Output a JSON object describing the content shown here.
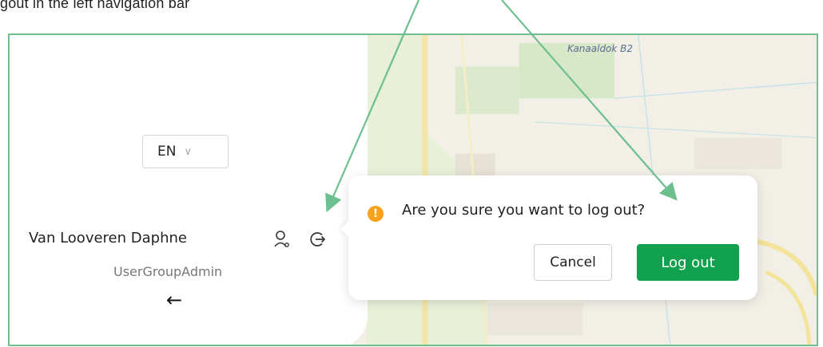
{
  "caption": "gout in the left navigation bar",
  "map": {
    "place_label": "Kanaaldok B2"
  },
  "sidebar": {
    "language": "EN",
    "user_name": "Van Looveren Daphne",
    "user_role": "UserGroupAdmin",
    "collapse_glyph": "←"
  },
  "popover": {
    "message": "Are you sure you want to log out?",
    "cancel_label": "Cancel",
    "confirm_label": "Log out"
  },
  "colors": {
    "annotation": "#6dbf8f",
    "confirm_button": "#11a14e",
    "warning": "#f7a11c"
  }
}
